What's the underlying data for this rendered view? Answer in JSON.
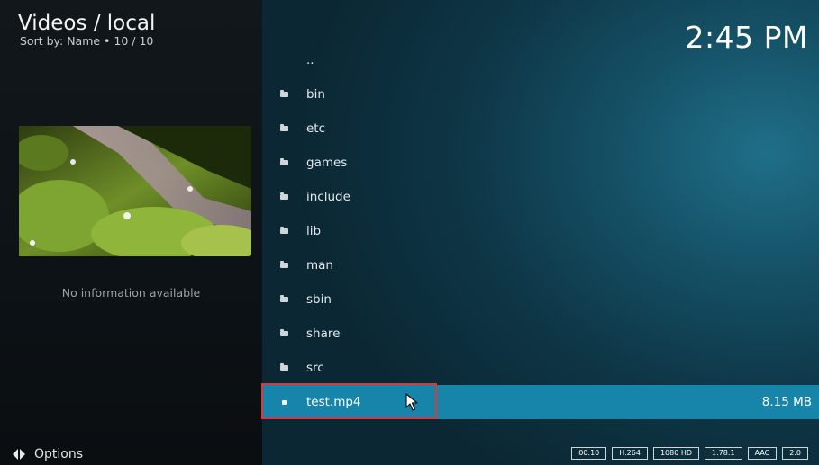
{
  "header": {
    "title": "Videos / local",
    "subtitle": "Sort by: Name  •  10 / 10",
    "clock": "2:45 PM"
  },
  "info": {
    "no_info_text": "No information available"
  },
  "list": [
    {
      "label": "..",
      "type": "parent"
    },
    {
      "label": "bin",
      "type": "folder"
    },
    {
      "label": "etc",
      "type": "folder"
    },
    {
      "label": "games",
      "type": "folder"
    },
    {
      "label": "include",
      "type": "folder"
    },
    {
      "label": "lib",
      "type": "folder"
    },
    {
      "label": "man",
      "type": "folder"
    },
    {
      "label": "sbin",
      "type": "folder"
    },
    {
      "label": "share",
      "type": "folder"
    },
    {
      "label": "src",
      "type": "folder"
    },
    {
      "label": "test.mp4",
      "type": "file",
      "size": "8.15 MB",
      "selected": true
    }
  ],
  "footer": {
    "options_label": "Options",
    "badges": [
      "00:10",
      "H.264",
      "1080 HD",
      "1.78:1",
      "AAC",
      "2.0"
    ]
  },
  "colors": {
    "accent_selected": "#1685a9",
    "highlight_outline": "#d53b3b"
  },
  "icons": {
    "folder": "folder-icon",
    "file": "file-icon",
    "options": "options-icon",
    "pointer": "mouse-pointer-icon"
  }
}
